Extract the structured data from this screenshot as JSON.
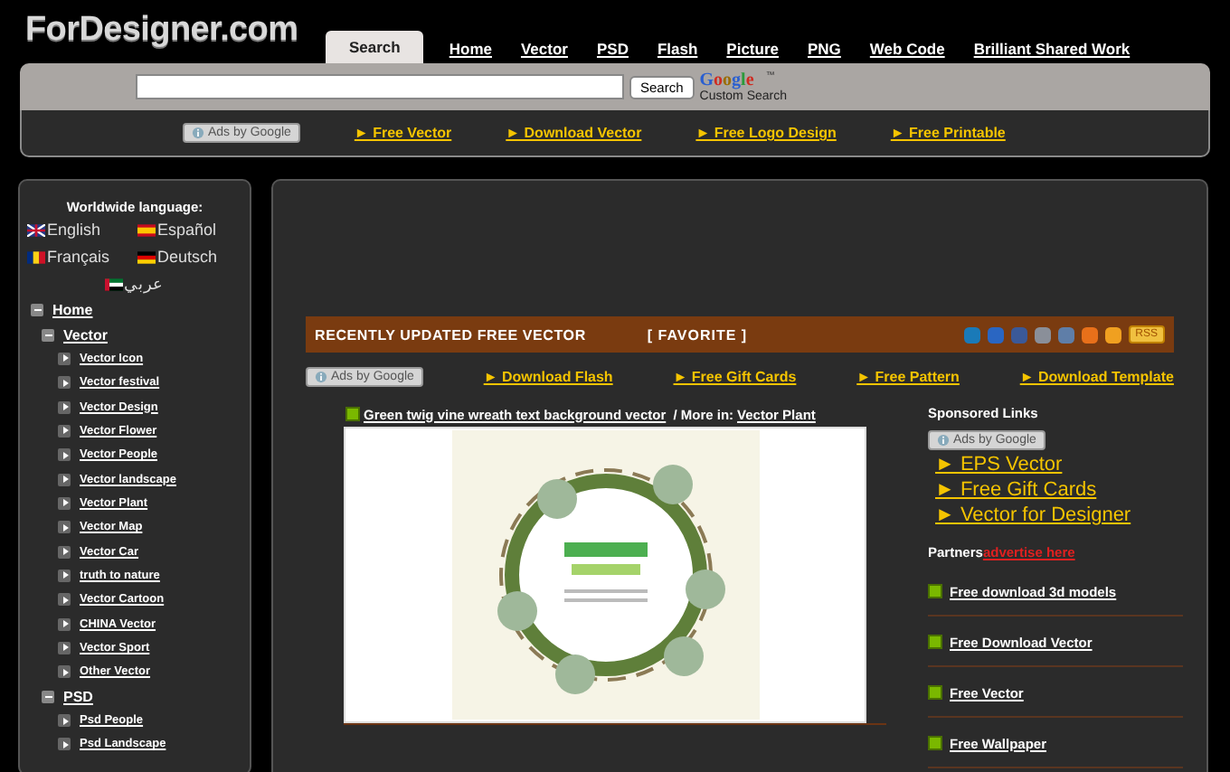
{
  "logo": "ForDesigner.com",
  "tabs": [
    {
      "label": "Search",
      "selected": true
    },
    {
      "label": "Home",
      "selected": false
    },
    {
      "label": "Vector",
      "selected": false
    },
    {
      "label": "PSD",
      "selected": false
    },
    {
      "label": "Flash",
      "selected": false
    },
    {
      "label": "Picture",
      "selected": false
    },
    {
      "label": "PNG",
      "selected": false
    },
    {
      "label": "Web Code",
      "selected": false
    },
    {
      "label": "Brilliant Shared Work",
      "selected": false
    }
  ],
  "search": {
    "button": "Search",
    "brand": "Google",
    "brand_mark": "™",
    "caption": "Custom Search"
  },
  "top_bar": {
    "ads": "Ads by Google",
    "links": [
      "► Free Vector",
      "► Download Vector",
      "► Free Logo Design",
      "► Free Printable"
    ]
  },
  "sidebar": {
    "title": "Worldwide language:",
    "languages": [
      {
        "label": "English",
        "kind": "british"
      },
      {
        "label": "Español",
        "kind": "spanish"
      },
      {
        "label": "Français",
        "kind": "romanian"
      },
      {
        "label": "Deutsch",
        "kind": "german"
      },
      {
        "label": "عربي",
        "kind": "emirati"
      }
    ],
    "tree": [
      {
        "label": "Home",
        "expanded": true,
        "children": [
          {
            "label": "Vector",
            "expanded": true,
            "children": [
              {
                "label": "Vector Icon"
              },
              {
                "label": "Vector festival"
              },
              {
                "label": "Vector Design"
              },
              {
                "label": "Vector Flower"
              },
              {
                "label": "Vector People"
              },
              {
                "label": "Vector landscape"
              },
              {
                "label": "Vector Plant"
              },
              {
                "label": "Vector Map"
              },
              {
                "label": "Vector Car"
              },
              {
                "label": "truth to nature"
              },
              {
                "label": "Vector Cartoon"
              },
              {
                "label": "CHINA Vector"
              },
              {
                "label": "Vector Sport"
              },
              {
                "label": "Other Vector"
              }
            ]
          },
          {
            "label": "PSD",
            "expanded": true,
            "children": [
              {
                "label": "Psd People"
              },
              {
                "label": "Psd Landscape"
              }
            ]
          }
        ]
      }
    ]
  },
  "section": {
    "title": "RECENTLY UPDATED FREE VECTOR",
    "favorite": "[ FAVORITE ]",
    "rss": "RSS"
  },
  "mid_bar": {
    "ads": "Ads by Google",
    "links": [
      "► Download Flash",
      "► Free Gift Cards",
      "► Free Pattern",
      "► Download Template"
    ]
  },
  "post": {
    "title": "Green twig vine wreath text background vector",
    "more": " / More in:",
    "category": "Vector Plant"
  },
  "sponsored": {
    "title": "Sponsored Links",
    "ads": "Ads by Google",
    "links": [
      "► EPS Vector",
      "► Free Gift Cards",
      "► Vector for Designer"
    ]
  },
  "partners": {
    "title": "Partners",
    "advertise": "advertise here",
    "links": [
      "Free download 3d models",
      "Free Download Vector",
      "Free Vector",
      "Free Wallpaper"
    ]
  }
}
